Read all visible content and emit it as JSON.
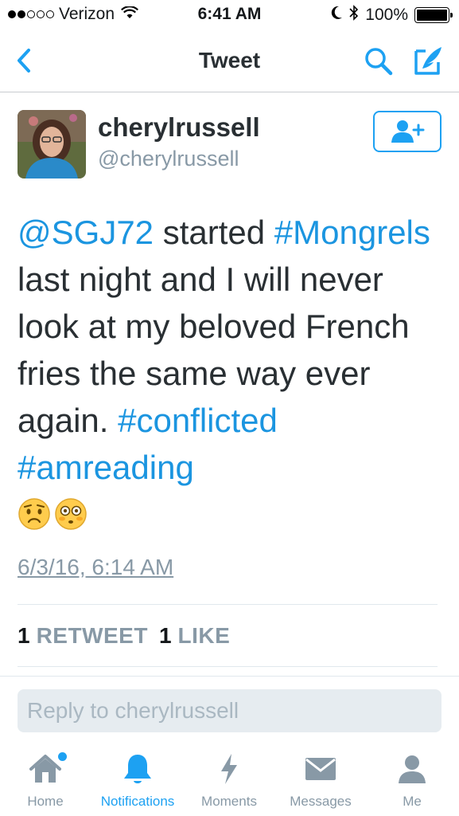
{
  "status_bar": {
    "carrier": "Verizon",
    "time": "6:41 AM",
    "battery": "100%",
    "signal_bars_filled": 2,
    "signal_bars_total": 5
  },
  "nav": {
    "title": "Tweet",
    "icons": [
      "back-chevron-icon",
      "search-icon",
      "compose-icon"
    ]
  },
  "tweet": {
    "display_name": "cherylrussell",
    "handle": "@cherylrussell",
    "text_parts": {
      "mention": "@SGJ72",
      "t1": " started ",
      "hashtag1": "#Mongrels",
      "t2": " last night and I will never look at my beloved French fries the same way ever again. ",
      "hashtag2": "#conflicted",
      "t3": " ",
      "hashtag3": "#amreading"
    },
    "emojis": [
      "worried-face-emoji",
      "flushed-face-emoji"
    ],
    "timestamp": "6/3/16, 6:14 AM",
    "retweet_count": "1",
    "retweet_label": "RETWEET",
    "like_count": "1",
    "like_label": "LIKE"
  },
  "reply": {
    "placeholder": "Reply to cherylrussell"
  },
  "tab_bar": {
    "tabs": [
      {
        "label": "Home",
        "icon": "home-icon"
      },
      {
        "label": "Notifications",
        "icon": "bell-icon",
        "active": true
      },
      {
        "label": "Moments",
        "icon": "lightning-icon"
      },
      {
        "label": "Messages",
        "icon": "envelope-icon"
      },
      {
        "label": "Me",
        "icon": "person-icon"
      }
    ]
  },
  "colors": {
    "accent": "#1da1f2",
    "link": "#1b95e0",
    "muted": "#8899a6"
  }
}
